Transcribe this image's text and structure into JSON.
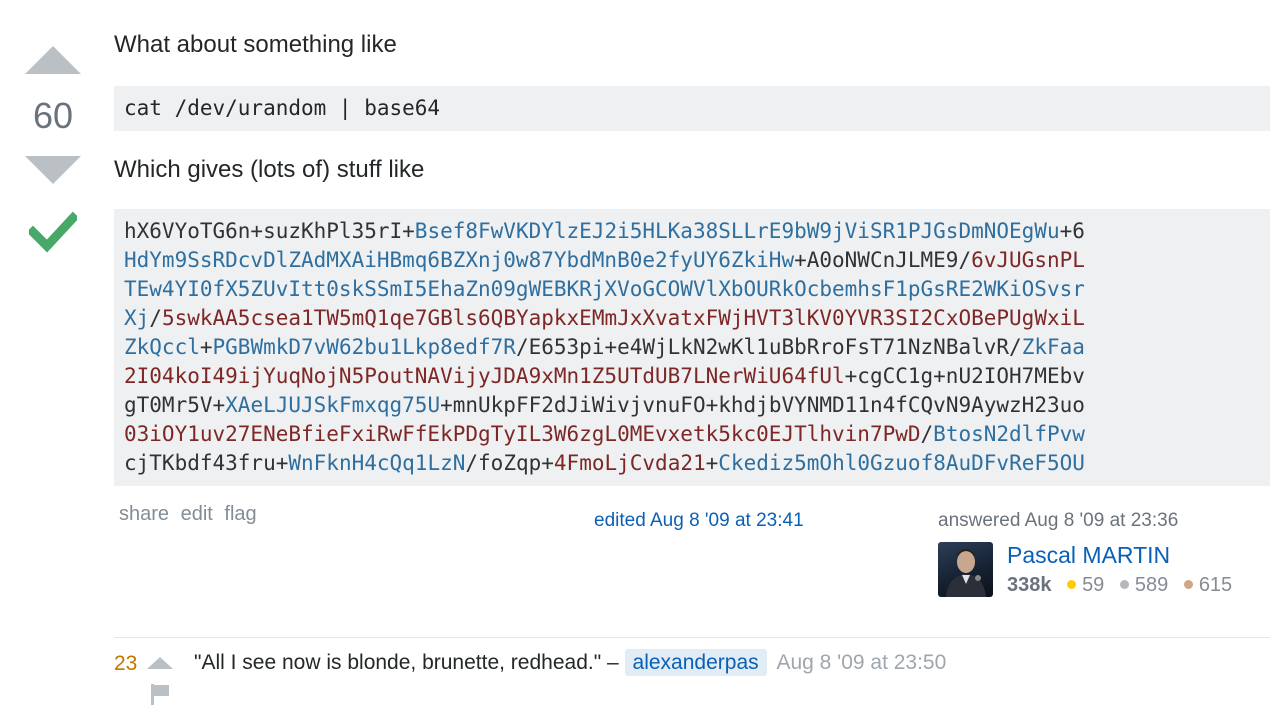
{
  "vote": {
    "score": "60"
  },
  "post": {
    "intro": "What about something like",
    "command": "cat /dev/urandom | base64",
    "middle": "Which gives (lots of) stuff like",
    "output_lines": [
      [
        [
          "p",
          "hX6VYoTG6n+suzKhPl35rI+"
        ],
        [
          "b",
          "Bsef8FwVKDYlzEJ2i5HLKa38SLLrE9bW9jViSR1PJGsDmNOEgWu"
        ],
        [
          "p",
          "+6"
        ]
      ],
      [
        [
          "b",
          "HdYm9SsRDcvDlZAdMXAiHBmq6BZXnj0w87YbdMnB0e2fyUY6ZkiHw"
        ],
        [
          "p",
          "+A0oNWCnJLME9/"
        ],
        [
          "r",
          "6vJUGsnPL"
        ]
      ],
      [
        [
          "b",
          "TEw4YI0fX5ZUvItt0skSSmI5EhaZn09gWEBKRjXVoGCOWVlXbOURkOcbemhsF1pGsRE2WKiOSvsr"
        ]
      ],
      [
        [
          "b",
          "Xj"
        ],
        [
          "p",
          "/"
        ],
        [
          "r",
          "5swkAA5csea1TW5mQ1qe7GBls6QBYapkxEMmJxXvatxFWjHVT3lKV0YVR3SI2CxOBePUgWxiL"
        ]
      ],
      [
        [
          "b",
          "ZkQccl"
        ],
        [
          "p",
          "+"
        ],
        [
          "b",
          "PGBWmkD7vW62bu1Lkp8edf7R"
        ],
        [
          "p",
          "/E653pi+e4WjLkN2wKl1uBbRroFsT71NzNBalvR/"
        ],
        [
          "b",
          "ZkFaa"
        ]
      ],
      [
        [
          "r",
          "2I04koI49ijYuqNojN5PoutNAVijyJDA9xMn1Z5UTdUB7LNerWiU64fUl"
        ],
        [
          "p",
          "+cgCC1g+nU2IOH7MEbv"
        ]
      ],
      [
        [
          "p",
          "gT0Mr5V+"
        ],
        [
          "b",
          "XAeLJUJSkFmxqg75U"
        ],
        [
          "p",
          "+mnUkpFF2dJiWivjvnuFO+khdjbVYNMD11n4fCQvN9AywzH23uo"
        ]
      ],
      [
        [
          "r",
          "03iOY1uv27ENeBfieFxiRwFfEkPDgTyIL3W6zgL0MEvxetk5kc0EJTlhvin7PwD"
        ],
        [
          "p",
          "/"
        ],
        [
          "b",
          "BtosN2dlfPvw"
        ]
      ],
      [
        [
          "p",
          "cjTKbdf43fru+"
        ],
        [
          "b",
          "WnFknH4cQq1LzN"
        ],
        [
          "p",
          "/foZqp+"
        ],
        [
          "r",
          "4FmoLjCvda21"
        ],
        [
          "p",
          "+"
        ],
        [
          "b",
          "Ckediz5mOhl0Gzuof8AuDFvReF5OU"
        ]
      ]
    ]
  },
  "menu": {
    "share": "share",
    "edit": "edit",
    "flag": "flag"
  },
  "edited": "edited Aug 8 '09 at 23:41",
  "answered": "answered Aug 8 '09 at 23:36",
  "user": {
    "name": "Pascal MARTIN",
    "rep": "338k",
    "gold": "59",
    "silver": "589",
    "bronze": "615",
    "colors": {
      "gold": "#ffcc01",
      "silver": "#b4b8bc",
      "bronze": "#d1a684"
    }
  },
  "comment": {
    "score": "23",
    "text": "\"All I see now is blonde, brunette, redhead.\" –",
    "user": "alexanderpas",
    "date": "Aug 8 '09 at 23:50"
  }
}
